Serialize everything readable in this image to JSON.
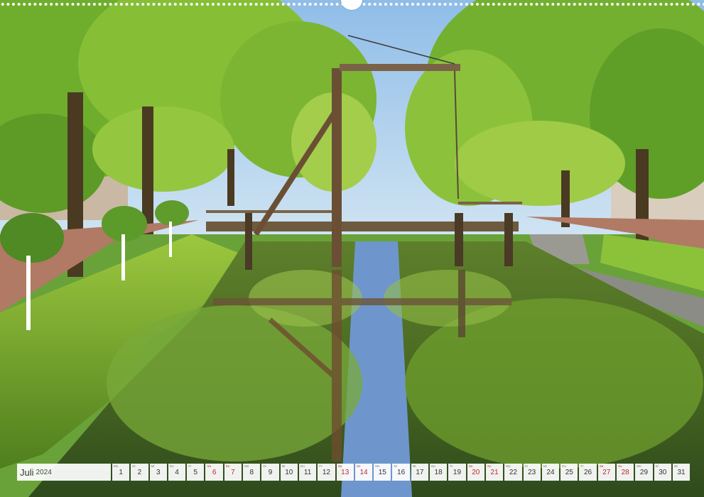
{
  "calendar": {
    "month": "Juli",
    "year": "2024",
    "days": [
      {
        "n": "1",
        "dow": "Mo",
        "weekend": false
      },
      {
        "n": "2",
        "dow": "Di",
        "weekend": false
      },
      {
        "n": "3",
        "dow": "Mi",
        "weekend": false
      },
      {
        "n": "4",
        "dow": "Do",
        "weekend": false
      },
      {
        "n": "5",
        "dow": "Fr",
        "weekend": false
      },
      {
        "n": "6",
        "dow": "Sa",
        "weekend": true
      },
      {
        "n": "7",
        "dow": "So",
        "weekend": true
      },
      {
        "n": "8",
        "dow": "Mo",
        "weekend": false
      },
      {
        "n": "9",
        "dow": "Di",
        "weekend": false
      },
      {
        "n": "10",
        "dow": "Mi",
        "weekend": false
      },
      {
        "n": "11",
        "dow": "Do",
        "weekend": false
      },
      {
        "n": "12",
        "dow": "Fr",
        "weekend": false
      },
      {
        "n": "13",
        "dow": "Sa",
        "weekend": true
      },
      {
        "n": "14",
        "dow": "So",
        "weekend": true
      },
      {
        "n": "15",
        "dow": "Mo",
        "weekend": false
      },
      {
        "n": "16",
        "dow": "Di",
        "weekend": false
      },
      {
        "n": "17",
        "dow": "Mi",
        "weekend": false
      },
      {
        "n": "18",
        "dow": "Do",
        "weekend": false
      },
      {
        "n": "19",
        "dow": "Fr",
        "weekend": false
      },
      {
        "n": "20",
        "dow": "Sa",
        "weekend": true
      },
      {
        "n": "21",
        "dow": "So",
        "weekend": true
      },
      {
        "n": "22",
        "dow": "Mo",
        "weekend": false
      },
      {
        "n": "23",
        "dow": "Di",
        "weekend": false
      },
      {
        "n": "24",
        "dow": "Mi",
        "weekend": false
      },
      {
        "n": "25",
        "dow": "Do",
        "weekend": false
      },
      {
        "n": "26",
        "dow": "Fr",
        "weekend": false
      },
      {
        "n": "27",
        "dow": "Sa",
        "weekend": true
      },
      {
        "n": "28",
        "dow": "So",
        "weekend": true
      },
      {
        "n": "29",
        "dow": "Mo",
        "weekend": false
      },
      {
        "n": "30",
        "dow": "Di",
        "weekend": false
      },
      {
        "n": "31",
        "dow": "Mi",
        "weekend": false
      }
    ]
  },
  "colors": {
    "sky": "#9cc7ea",
    "foliage": "#6fae2c",
    "foliage_light": "#a6d24a",
    "water": "#4f6b2a",
    "weekend_text": "#c0282c"
  }
}
